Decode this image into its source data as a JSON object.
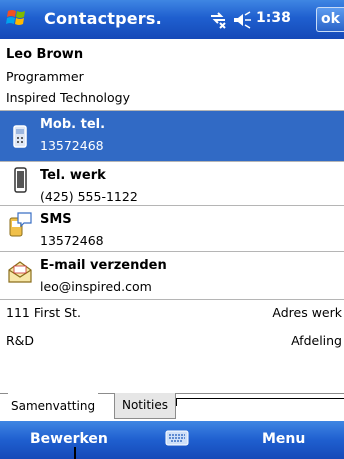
{
  "titlebar": {
    "app_title": "Contactpers.",
    "clock": "1:38",
    "ok_label": "ok"
  },
  "contact": {
    "name": "Leo Brown",
    "job_title": "Programmer",
    "company": "Inspired Technology"
  },
  "fields": [
    {
      "label": "Mob. tel.",
      "value": "13572468",
      "icon": "mobile-phone-icon",
      "selected": true
    },
    {
      "label": "Tel. werk",
      "value": "(425) 555-1122",
      "icon": "desk-phone-icon",
      "selected": false
    },
    {
      "label": "SMS",
      "value": "13572468",
      "icon": "sms-icon",
      "selected": false
    },
    {
      "label": "E-mail verzenden",
      "value": "leo@inspired.com",
      "icon": "envelope-icon",
      "selected": false
    }
  ],
  "details": [
    {
      "value": "111 First St.",
      "label": "Adres werk"
    },
    {
      "value": "R&D",
      "label": "Afdeling"
    }
  ],
  "tabs": {
    "summary": "Samenvatting",
    "notes": "Notities"
  },
  "menubar": {
    "left_soft_key": "Bewerken",
    "right_soft_key": "Menu",
    "input_icon": "keyboard-icon"
  },
  "colors": {
    "bar_blue": "#1f5fcf",
    "selection_blue": "#316ac5"
  }
}
